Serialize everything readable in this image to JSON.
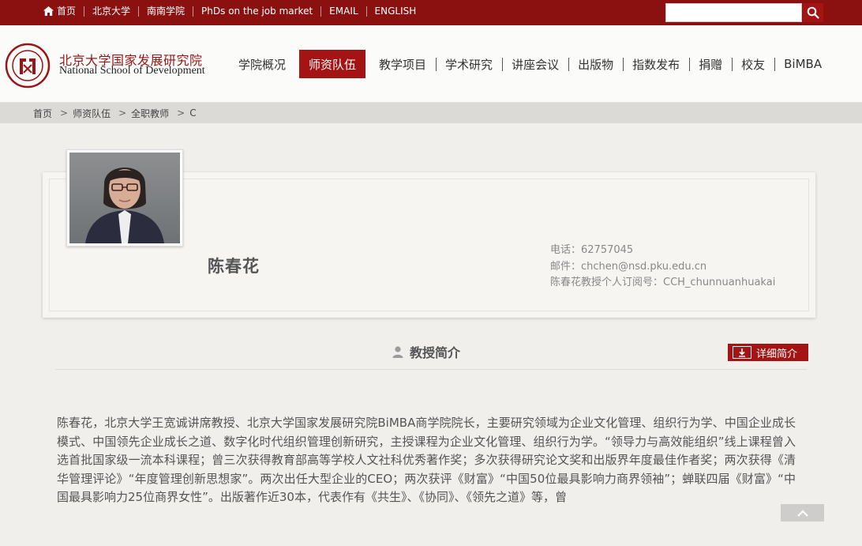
{
  "topbar": {
    "links": [
      "首页",
      "北京大学",
      "南南学院",
      "PhDs on the job market",
      "EMAIL",
      "ENGLISH"
    ],
    "search": {
      "placeholder": "",
      "value": ""
    }
  },
  "header": {
    "logo_cn": "北京大学国家发展研究院",
    "logo_en": "National School of Development",
    "nav": [
      "学院概况",
      "师资队伍",
      "教学项目",
      "学术研究",
      "讲座会议",
      "出版物",
      "指数发布",
      "捐赠",
      "校友",
      "BiMBA"
    ],
    "active_nav": "师资队伍"
  },
  "breadcrumb": [
    "首页",
    "师资队伍",
    "全职教师",
    "C"
  ],
  "profile": {
    "name": "陈春花",
    "phone": "电话：62757045",
    "email": "邮件：chchen@nsd.pku.edu.cn",
    "subscription": "陈春花教授个人订阅号：CCH_chunnuanhuakai"
  },
  "section": {
    "title": "教授简介",
    "detail_button": "详细简介",
    "bio": "陈春花，北京大学王宽诚讲席教授、北京大学国家发展研究院BiMBA商学院院长，主要研究领域为企业文化管理、组织行为学、中国企业成长模式、中国领先企业成长之道、数字化时代组织管理创新研究，主授课程为企业文化管理、组织行为学。“领导力与高效能组织”线上课程曾入选首批国家级一流本科课程；曾三次获得教育部高等学校人文社科优秀著作奖；多次获得研究论文奖和出版界年度最佳作者奖；两次获得《清华管理评论》“年度管理创新思想家”。两次出任大型企业的CEO；两次获评《财富》“中国50位最具影响力商界领袖”；蝉联四届《财富》“中国最具影响力25位商界女性”。出版著作近30本，代表作有《共生》、《协同》、《领先之道》等，曾"
  },
  "colors": {
    "brand_red": "#8b1111",
    "accent_red": "#a51414"
  },
  "icons": [
    "home-icon",
    "search-icon",
    "person-icon",
    "download-icon",
    "chevron-up-icon",
    "university-seal-icon"
  ]
}
